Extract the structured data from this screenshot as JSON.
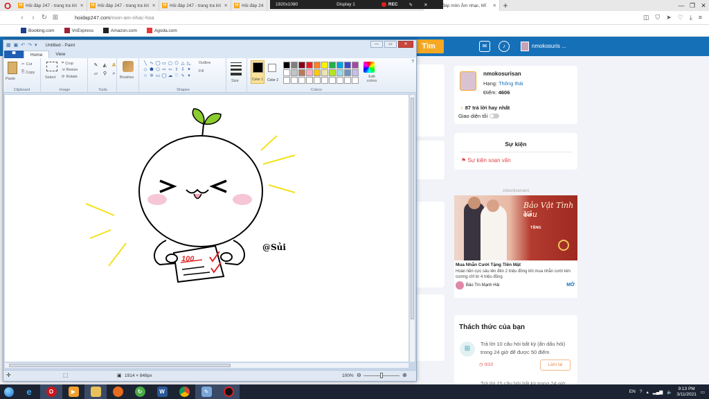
{
  "browser": {
    "tabs": [
      {
        "label": "Hỏi đáp 247 - trang tra lời"
      },
      {
        "label": "Hỏi đáp 247 - trang tra lời"
      },
      {
        "label": "Hỏi đáp 247 - trang tra lời"
      },
      {
        "label": "Hỏi đáp 24"
      },
      {
        "label": "Hỏi đáp môn Âm nhạc, Mĩ"
      }
    ],
    "recorder": {
      "resolution": "1920x1080",
      "display": "Display 1",
      "rec": "REC"
    },
    "url_host": "hoidap247.com",
    "url_path": "/mon-am-nhac-hoa",
    "bookmarks": [
      "Booking.com",
      "VnExpress",
      "Amazon.com",
      "Agoda.com"
    ]
  },
  "site": {
    "search_button": "Tìm",
    "header_user": "nmokosuris ...",
    "profile": {
      "name": "nmokosurisan",
      "rank_label": "Hạng:",
      "rank_value": "Thông thái",
      "points_label": "Điểm:",
      "points_value": "4606",
      "best_answers": "87 trả lời hay nhất",
      "dark_mode": "Giao diện tối"
    },
    "events": {
      "title": "Sự kiện",
      "item": "Sự kiện soạn văn"
    },
    "ad": {
      "label": "Advertisement",
      "title": "Bảo Vật Tình Yêu",
      "headline": "Mua Nhẫn Cưới Tặng Tiền Mặt",
      "desc": "Hoàn tiền cực sâu lên đến 2 triệu đồng khi mua nhẫn cưới kim cương chỉ từ 4 triệu đồng",
      "brand": "Bảo Tín Mạnh Hải",
      "open": "MỞ",
      "img_text1": "MUA",
      "img_text2": "TẶNG"
    },
    "challenge": {
      "title": "Thách thức của bạn",
      "task": "Trả lời 10 câu hỏi bất kỳ (ẩn dấu hỏi) trong 24 giờ để được 50 điểm",
      "progress": "0/10",
      "button": "Làm lại",
      "task2": "Trả lời 15 câu hỏi bất kỳ trong 24 giờ"
    }
  },
  "paint": {
    "title": "Untitled - Paint",
    "tabs": {
      "file": "▀",
      "home": "Home",
      "view": "View"
    },
    "groups": {
      "clipboard": "Clipboard",
      "image": "Image",
      "tools": "Tools",
      "shapes": "Shapes",
      "colors": "Colors"
    },
    "buttons": {
      "paste": "Paste",
      "cut": "Cut",
      "copy": "Copy",
      "select": "Select",
      "crop": "Crop",
      "resize": "Resize",
      "rotate": "Rotate",
      "brushes": "Brushes",
      "outline": "Outline",
      "fill": "Fill",
      "size": "Size",
      "color1": "Color 1",
      "color2": "Color 2",
      "edit_colors": "Edit colors"
    },
    "palette": [
      "#000000",
      "#7f7f7f",
      "#880015",
      "#ed1c24",
      "#ff7f27",
      "#fff200",
      "#22b14c",
      "#00a2e8",
      "#3f48cc",
      "#a349a4",
      "#ffffff",
      "#c3c3c3",
      "#b97a57",
      "#ffaec9",
      "#ffc90e",
      "#efe4b0",
      "#b5e61d",
      "#99d9ea",
      "#7092be",
      "#c8bfe7",
      "#ffffff",
      "#ffffff",
      "#ffffff",
      "#ffffff",
      "#ffffff",
      "#ffffff",
      "#ffffff",
      "#ffffff",
      "#ffffff",
      "#ffffff"
    ],
    "drawing": {
      "signature": "@Sủi",
      "paper_text": "100"
    },
    "status": {
      "dimensions": "1914 × 848px",
      "zoom": "100%"
    }
  },
  "taskbar": {
    "time": "9:13 PM",
    "date": "3/11/2021",
    "lang": "EN"
  }
}
